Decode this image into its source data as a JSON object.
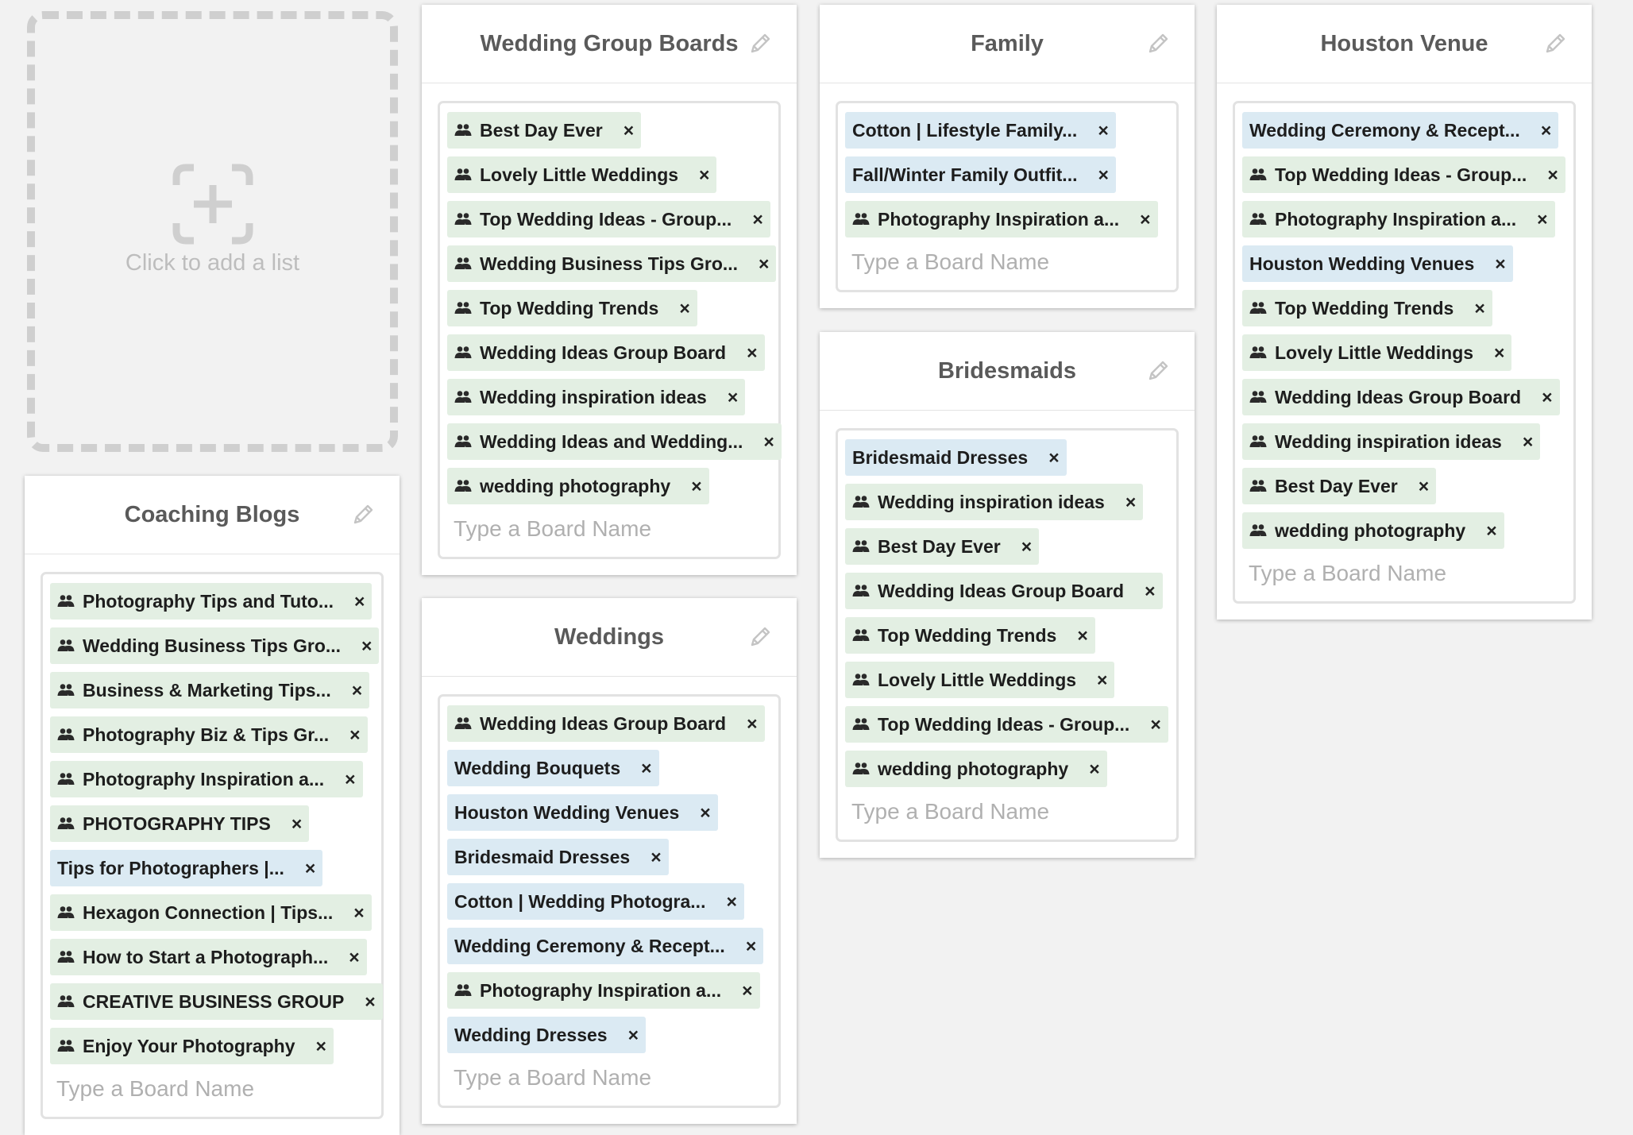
{
  "add_list": {
    "label": "Click to add a list"
  },
  "placeholder": "Type a Board Name",
  "lists": [
    {
      "title": "Coaching Blogs",
      "tags": [
        {
          "label": "Photography Tips and Tuto...",
          "type": "group"
        },
        {
          "label": "Wedding Business Tips Gro...",
          "type": "group"
        },
        {
          "label": "Business & Marketing Tips...",
          "type": "group"
        },
        {
          "label": "Photography Biz & Tips Gr...",
          "type": "group"
        },
        {
          "label": "Photography Inspiration a...",
          "type": "group"
        },
        {
          "label": "PHOTOGRAPHY TIPS",
          "type": "group"
        },
        {
          "label": "Tips for Photographers |...",
          "type": "board"
        },
        {
          "label": "Hexagon Connection | Tips...",
          "type": "group"
        },
        {
          "label": "How to Start a Photograph...",
          "type": "group"
        },
        {
          "label": "CREATIVE BUSINESS GROUP",
          "type": "group"
        },
        {
          "label": "Enjoy Your Photography",
          "type": "group"
        }
      ]
    },
    {
      "title": "Wedding Group Boards",
      "tags": [
        {
          "label": "Best Day Ever",
          "type": "group"
        },
        {
          "label": "Lovely Little Weddings",
          "type": "group"
        },
        {
          "label": "Top Wedding Ideas - Group...",
          "type": "group"
        },
        {
          "label": "Wedding Business Tips Gro...",
          "type": "group"
        },
        {
          "label": "Top Wedding Trends",
          "type": "group"
        },
        {
          "label": "Wedding Ideas Group Board",
          "type": "group"
        },
        {
          "label": "Wedding inspiration ideas",
          "type": "group"
        },
        {
          "label": "Wedding Ideas and Wedding...",
          "type": "group"
        },
        {
          "label": "wedding photography",
          "type": "group"
        }
      ]
    },
    {
      "title": "Weddings",
      "tags": [
        {
          "label": "Wedding Ideas Group Board",
          "type": "group"
        },
        {
          "label": "Wedding Bouquets",
          "type": "board"
        },
        {
          "label": "Houston Wedding Venues",
          "type": "board"
        },
        {
          "label": "Bridesmaid Dresses",
          "type": "board"
        },
        {
          "label": "Cotton | Wedding Photogra...",
          "type": "board"
        },
        {
          "label": "Wedding Ceremony & Recept...",
          "type": "board"
        },
        {
          "label": "Photography Inspiration a...",
          "type": "group"
        },
        {
          "label": "Wedding Dresses",
          "type": "board"
        }
      ]
    },
    {
      "title": "Family",
      "tags": [
        {
          "label": "Cotton | Lifestyle Family...",
          "type": "board"
        },
        {
          "label": "Fall/Winter Family Outfit...",
          "type": "board"
        },
        {
          "label": "Photography Inspiration a...",
          "type": "group"
        }
      ]
    },
    {
      "title": "Bridesmaids",
      "tags": [
        {
          "label": "Bridesmaid Dresses",
          "type": "board"
        },
        {
          "label": "Wedding inspiration ideas",
          "type": "group"
        },
        {
          "label": "Best Day Ever",
          "type": "group"
        },
        {
          "label": "Wedding Ideas Group Board",
          "type": "group"
        },
        {
          "label": "Top Wedding Trends",
          "type": "group"
        },
        {
          "label": "Lovely Little Weddings",
          "type": "group"
        },
        {
          "label": "Top Wedding Ideas - Group...",
          "type": "group"
        },
        {
          "label": "wedding photography",
          "type": "group"
        }
      ]
    },
    {
      "title": "Houston Venue",
      "tags": [
        {
          "label": "Wedding Ceremony & Recept...",
          "type": "board"
        },
        {
          "label": "Top Wedding Ideas - Group...",
          "type": "group"
        },
        {
          "label": "Photography Inspiration a...",
          "type": "group"
        },
        {
          "label": "Houston Wedding Venues",
          "type": "board"
        },
        {
          "label": "Top Wedding Trends",
          "type": "group"
        },
        {
          "label": "Lovely Little Weddings",
          "type": "group"
        },
        {
          "label": "Wedding Ideas Group Board",
          "type": "group"
        },
        {
          "label": "Wedding inspiration ideas",
          "type": "group"
        },
        {
          "label": "Best Day Ever",
          "type": "group"
        },
        {
          "label": "wedding photography",
          "type": "group"
        }
      ]
    }
  ],
  "remove_glyph": "×",
  "icons": {
    "group": "group-icon",
    "edit": "pencil-icon",
    "add": "add-list-icon"
  },
  "colors": {
    "group_tag": "#e3efe3",
    "board_tag": "#dbeaf3",
    "background": "#f2f2f2"
  }
}
